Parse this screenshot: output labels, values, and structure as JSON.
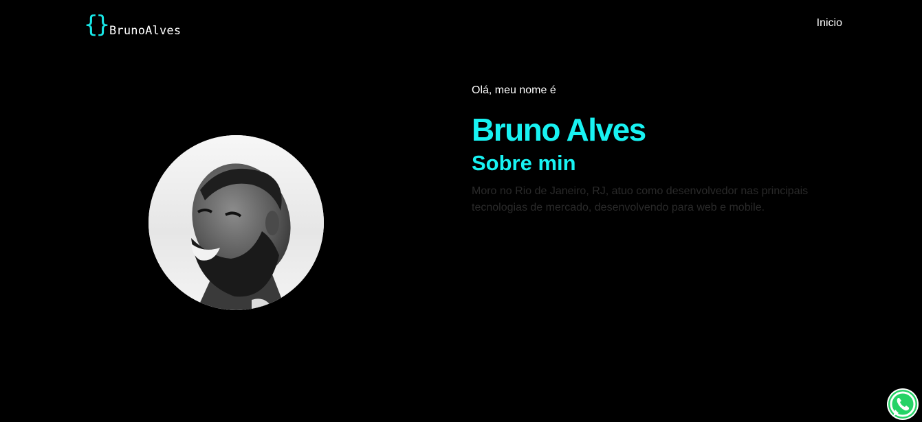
{
  "header": {
    "logo_braces": "{}",
    "logo_text": "BrunoAlves",
    "nav": [
      {
        "label": "Inicio"
      }
    ]
  },
  "hero": {
    "greeting": "Olá, meu nome é",
    "name": "Bruno Alves",
    "about_title": "Sobre min",
    "about_text": "Moro no Rio de Janeiro, RJ, atuo como desenvolvedor nas principais tecnologias de mercado, desenvolvendo para web e mobile."
  },
  "profile": {
    "photo": "profile-photo"
  },
  "floating": {
    "icon": "whatsapp-icon"
  },
  "colors": {
    "background": "#000000",
    "accent": "#18f2f2",
    "text": "#ffffff",
    "muted_text": "#2a2a2a",
    "whatsapp_green": "#25d366"
  }
}
